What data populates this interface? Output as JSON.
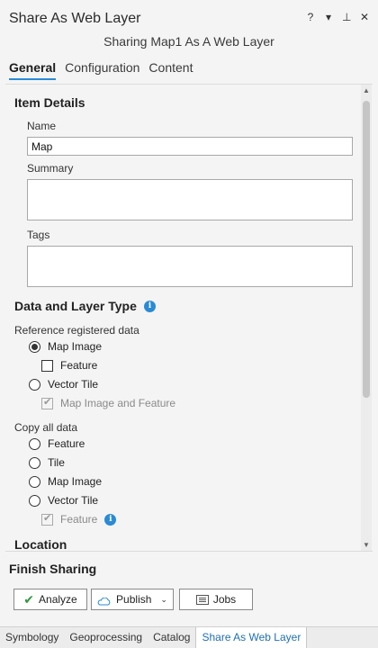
{
  "pane": {
    "title": "Share As Web Layer",
    "subtitle": "Sharing Map1 As A Web Layer",
    "icons": {
      "help": "?",
      "menu": "▾",
      "pin": "⊥",
      "close": "✕"
    }
  },
  "tabs": [
    {
      "label": "General",
      "active": true
    },
    {
      "label": "Configuration",
      "active": false
    },
    {
      "label": "Content",
      "active": false
    }
  ],
  "item_details": {
    "heading": "Item Details",
    "name_label": "Name",
    "name_value": "Map",
    "summary_label": "Summary",
    "summary_value": "",
    "tags_label": "Tags",
    "tags_value": ""
  },
  "data_layer": {
    "heading": "Data and Layer Type",
    "reference_label": "Reference registered data",
    "ref_options": {
      "map_image": "Map Image",
      "feature": "Feature",
      "vector_tile": "Vector Tile",
      "map_image_and_feature": "Map Image and Feature"
    },
    "copy_label": "Copy all data",
    "copy_options": {
      "feature": "Feature",
      "tile": "Tile",
      "map_image": "Map Image",
      "vector_tile": "Vector Tile",
      "feature_sub": "Feature"
    }
  },
  "location": {
    "heading": "Location"
  },
  "finish": {
    "heading": "Finish Sharing",
    "analyze": "Analyze",
    "publish": "Publish",
    "jobs": "Jobs"
  },
  "bottom_tabs": [
    {
      "label": "Symbology",
      "active": false
    },
    {
      "label": "Geoprocessing",
      "active": false
    },
    {
      "label": "Catalog",
      "active": false
    },
    {
      "label": "Share As Web Layer",
      "active": true
    }
  ],
  "colors": {
    "accent": "#2a8ad6",
    "check_green": "#2e9b3e"
  }
}
